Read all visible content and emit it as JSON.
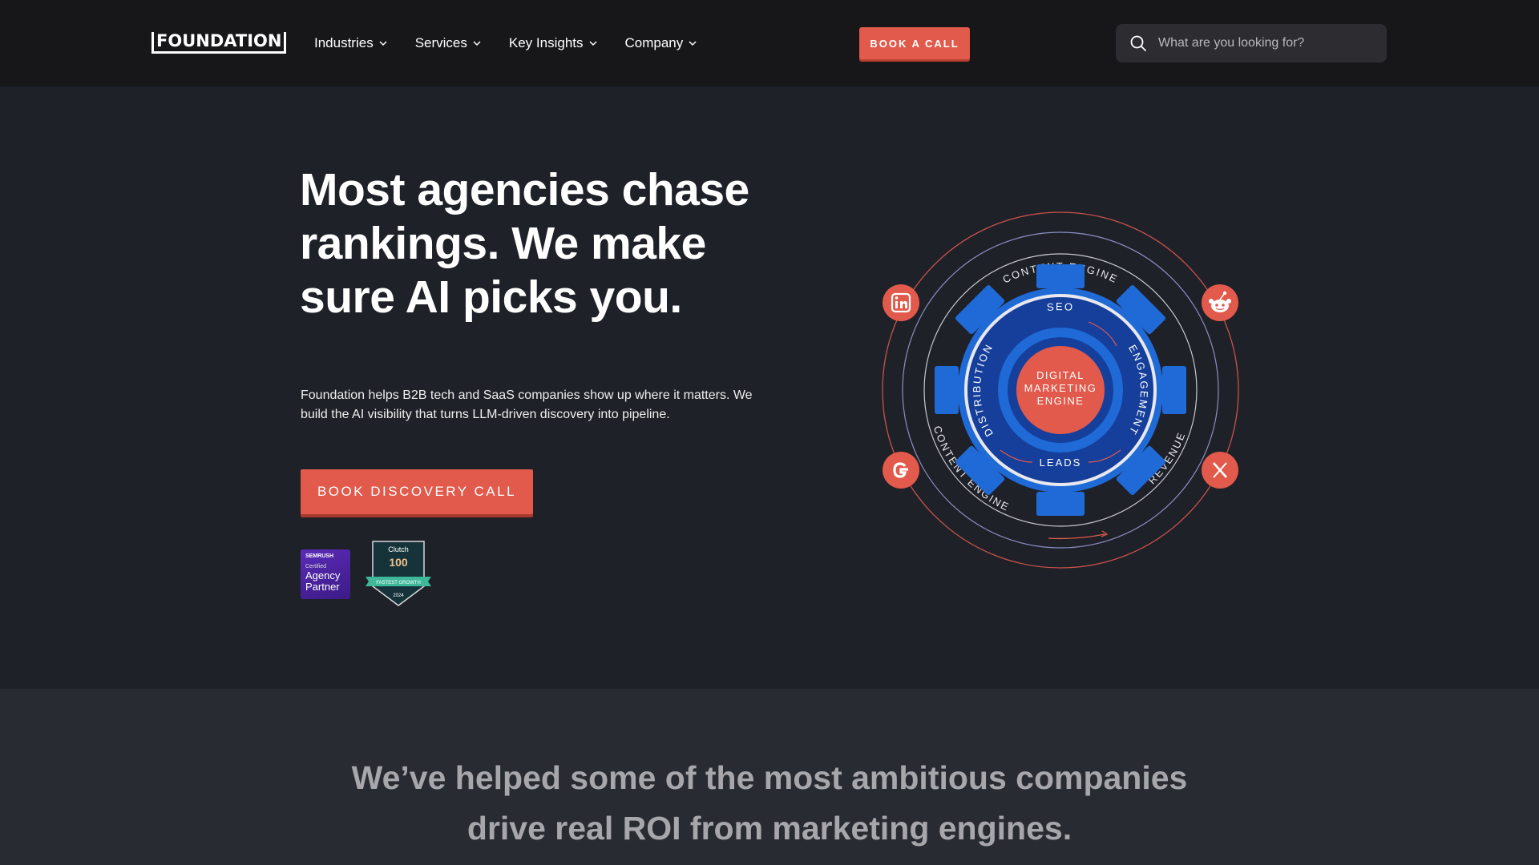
{
  "header": {
    "logo": "FOUNDATION",
    "nav": [
      {
        "label": "Industries"
      },
      {
        "label": "Services"
      },
      {
        "label": "Key Insights"
      },
      {
        "label": "Company"
      }
    ],
    "cta_label": "BOOK A CALL",
    "search_placeholder": "What are you looking for?"
  },
  "hero": {
    "title": "Most agencies chase rankings. We make sure AI picks you.",
    "description": "Foundation helps B2B tech and SaaS companies show up where it matters. We build the AI visibility that turns LLM-driven discovery into pipeline.",
    "cta_label": "BOOK DISCOVERY CALL",
    "badges": {
      "semrush": {
        "brand": "SEMRUSH",
        "line1": "Certified",
        "line2": "Agency",
        "line3": "Partner"
      },
      "clutch": {
        "brand": "Clutch",
        "number": "100",
        "ribbon": "FASTEST GROWTH",
        "year": "2024"
      }
    }
  },
  "diagram": {
    "outer_top": "CONTENT ENGINE",
    "outer_bottom_left": "CONTENT ENGINE",
    "outer_bottom_right": "REVENUE",
    "gear_top": "SEO",
    "gear_left": "DISTRIBUTION",
    "gear_right": "ENGAGEMENT",
    "gear_bottom": "LEADS",
    "center_line1": "DIGITAL",
    "center_line2": "MARKETING",
    "center_line3": "ENGINE",
    "icons": [
      "linkedin-icon",
      "reddit-icon",
      "google-icon",
      "x-icon"
    ],
    "colors": {
      "accent": "#e15a4c",
      "gear": "#1f6ad6",
      "gear_dark": "#163f9c"
    }
  },
  "section2": {
    "heading_line1": "We’ve helped some of the most ambitious companies",
    "heading_line2": "drive real ROI from marketing engines."
  }
}
